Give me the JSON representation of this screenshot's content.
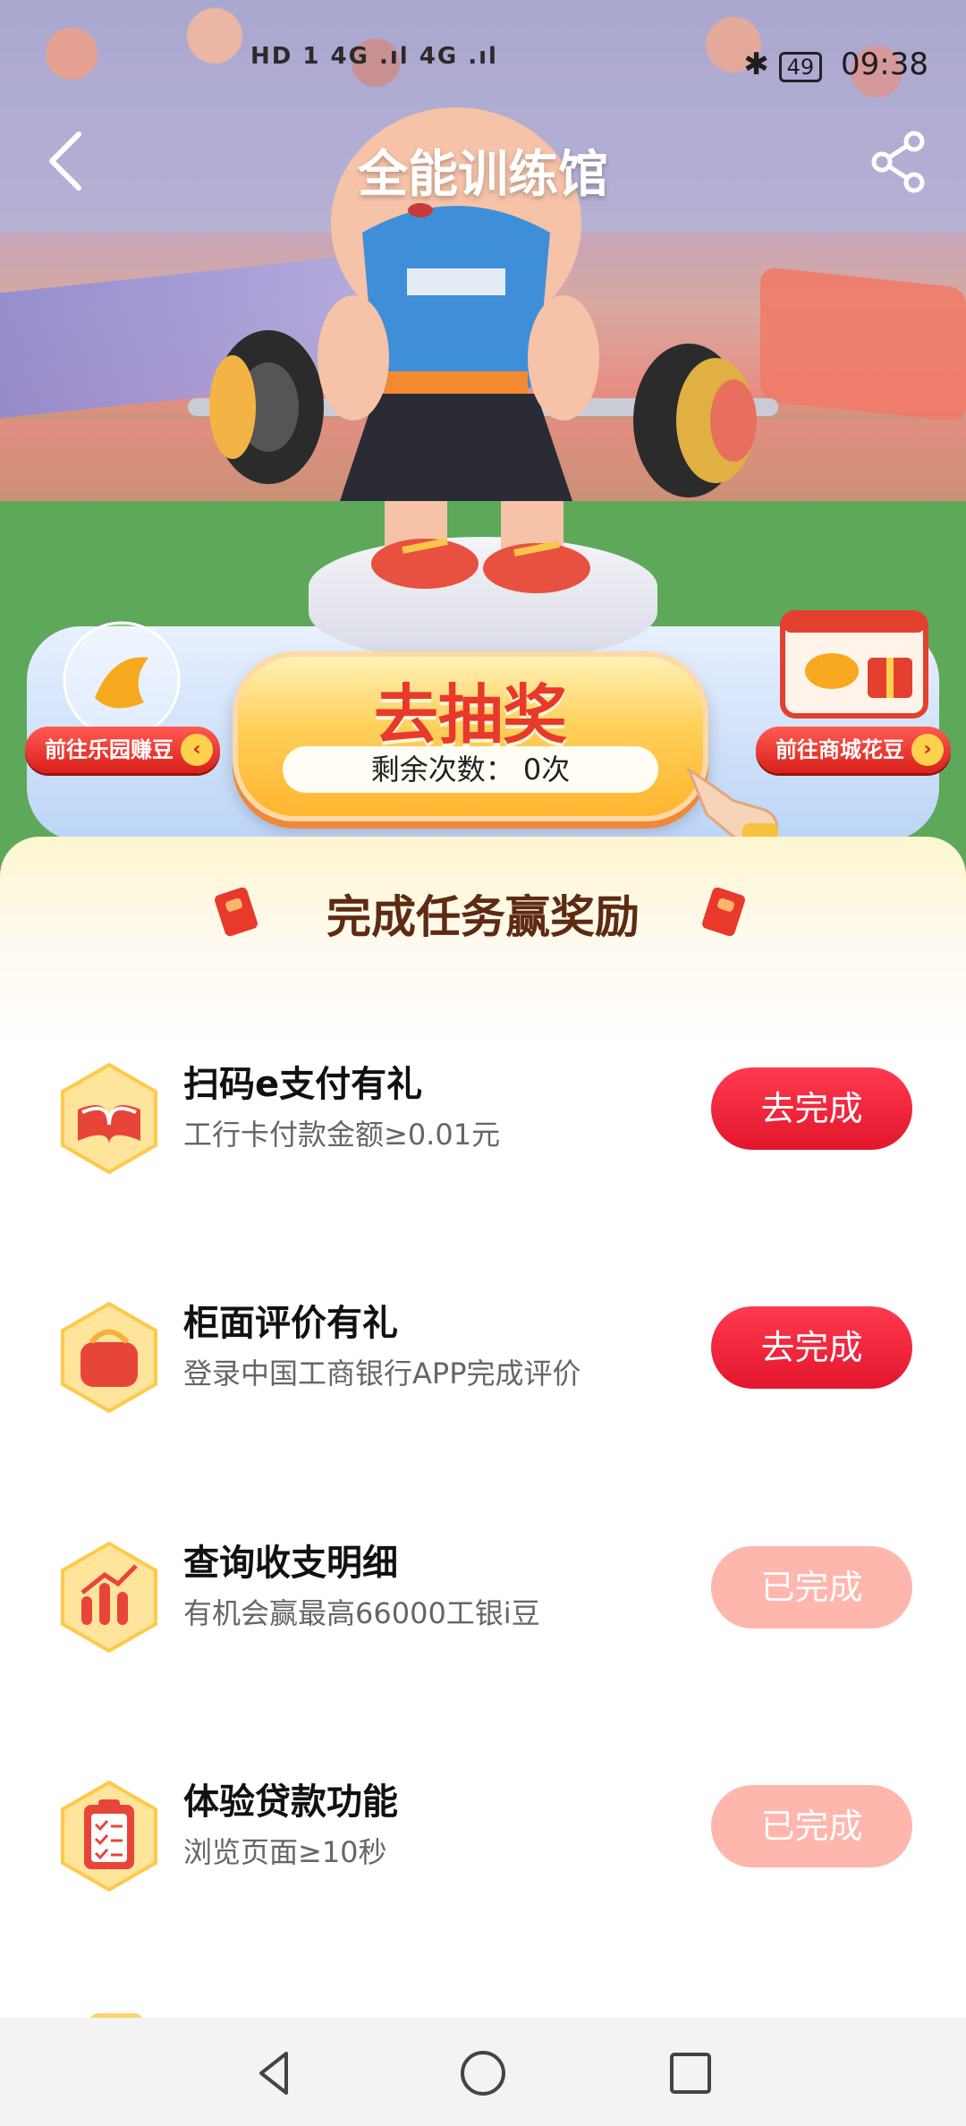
{
  "status_bar": {
    "network": "HD 1 4G .ıl 4G .ıl",
    "battery": "49",
    "time": "09:38"
  },
  "header": {
    "title": "全能训练馆"
  },
  "hero": {
    "left_link": "前往乐园赚豆",
    "right_link": "前往商城花豆",
    "lottery_label": "去抽奖",
    "remaining_label": "剩余次数：",
    "remaining_value": "0次"
  },
  "tasks_section": {
    "title": "完成任务赢奖励",
    "tasks": [
      {
        "icon": "book-icon",
        "title": "扫码e支付有礼",
        "desc": "工行卡付款金额≥0.01元",
        "button": "去完成",
        "status": "active"
      },
      {
        "icon": "wallet-icon",
        "title": "柜面评价有礼",
        "desc": "登录中国工商银行APP完成评价",
        "button": "去完成",
        "status": "active"
      },
      {
        "icon": "chart-icon",
        "title": "查询收支明细",
        "desc": "有机会赢最高66000工银i豆",
        "button": "已完成",
        "status": "done"
      },
      {
        "icon": "clipboard-icon",
        "title": "体验贷款功能",
        "desc": "浏览页面≥10秒",
        "button": "已完成",
        "status": "done"
      }
    ]
  },
  "colors": {
    "accent_red": "#e2162c",
    "done_pink": "#ffb6ad",
    "title_brown": "#5d2a12"
  }
}
